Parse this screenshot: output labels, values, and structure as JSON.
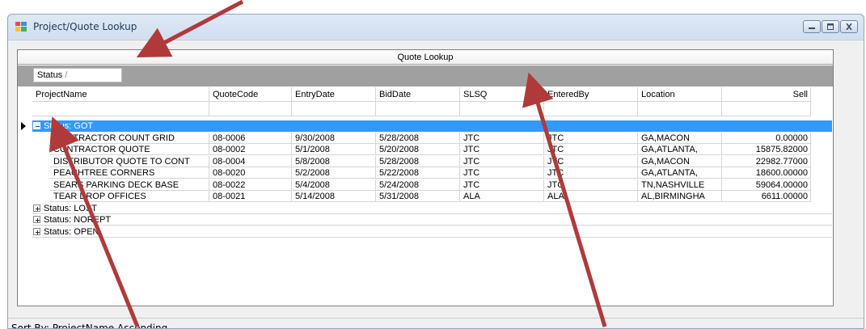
{
  "window": {
    "title": "Project/Quote Lookup"
  },
  "grid": {
    "caption": "Quote Lookup",
    "group_by_chip": "Status",
    "sort_glyph": "/",
    "columns": [
      "ProjectName",
      "QuoteCode",
      "EntryDate",
      "BidDate",
      "SLSQ",
      "EnteredBy",
      "Location",
      "Sell"
    ],
    "groups": [
      {
        "label": "Status: GOT",
        "expanded": true,
        "selected": true,
        "rows": [
          [
            "CONTRACTOR COUNT GRID",
            "08-0006",
            "9/30/2008",
            "5/28/2008",
            "JTC",
            "JTC",
            "GA,MACON",
            "0.00000"
          ],
          [
            "CONTRACTOR QUOTE",
            "08-0002",
            "5/1/2008",
            "5/20/2008",
            "JTC",
            "JTC",
            "GA,ATLANTA,",
            "15875.82000"
          ],
          [
            "DISTRIBUTOR QUOTE TO CONT",
            "08-0004",
            "5/8/2008",
            "5/28/2008",
            "JTC",
            "JTC",
            "GA,MACON",
            "22982.77000"
          ],
          [
            "PEACHTREE CORNERS",
            "08-0020",
            "5/2/2008",
            "5/22/2008",
            "JTC",
            "JTC",
            "GA,ATLANTA,",
            "18600.00000"
          ],
          [
            "SEARS PARKING DECK BASE",
            "08-0022",
            "5/4/2008",
            "5/24/2008",
            "JTC",
            "JTC",
            "TN,NASHVILLE",
            "59064.00000"
          ],
          [
            "TEAR DROP OFFICES",
            "08-0021",
            "5/14/2008",
            "5/31/2008",
            "ALA",
            "ALA",
            "AL,BIRMINGHA",
            "6611.00000"
          ]
        ]
      },
      {
        "label": "Status: LOST",
        "expanded": false,
        "rows": []
      },
      {
        "label": "Status: NOREPT",
        "expanded": false,
        "rows": []
      },
      {
        "label": "Status: OPEN",
        "expanded": false,
        "rows": []
      }
    ]
  },
  "status_bar": {
    "text": "Sort By: ProjectName Ascending"
  },
  "colors": {
    "selection": "#3399ff",
    "group_panel": "#a0a0a0",
    "annotation_arrow": "#b03a3a"
  }
}
